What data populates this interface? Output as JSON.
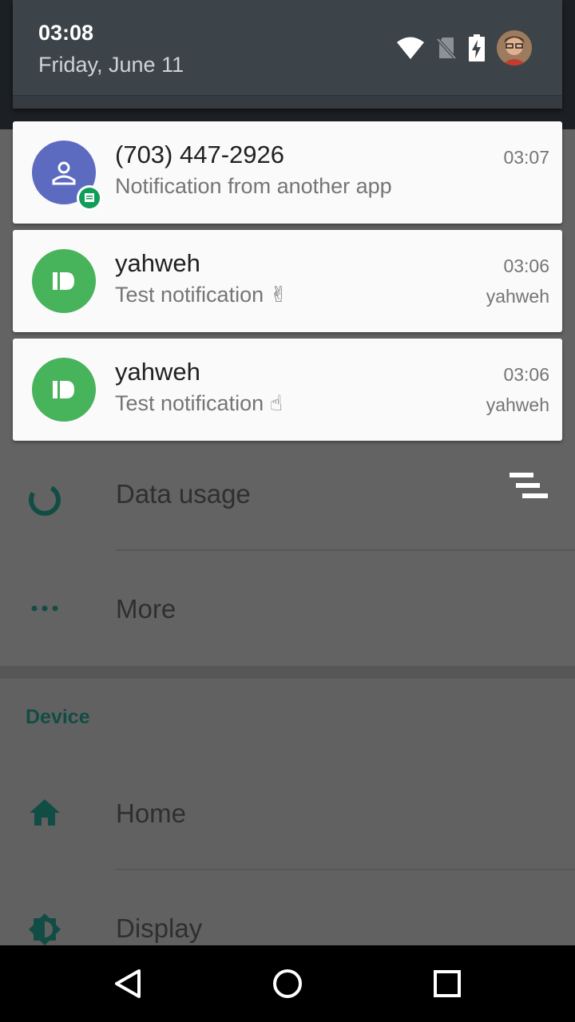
{
  "status": {
    "time": "03:08",
    "date": "Friday, June 11"
  },
  "icons": {
    "wifi": "wifi-icon",
    "no_sim": "no-sim-icon",
    "battery": "battery-charging-icon",
    "avatar": "user-avatar",
    "notification_contact": "person-icon",
    "notification_app": "pushbullet-icon",
    "badge": "sms-message-icon",
    "data_usage": "data-usage-icon",
    "more": "more-dots-icon",
    "home": "home-icon",
    "display": "brightness-icon",
    "dismiss_all": "clear-all-icon"
  },
  "colors": {
    "contact_circle": "#5c6bc0",
    "app_circle": "#47b35b",
    "badge_green": "#0f9d58",
    "section_title": "#124d45",
    "settings_icon": "#124d45"
  },
  "notifications": [
    {
      "title": "(703) 447-2926",
      "text": "Notification from another app",
      "time": "03:07",
      "sub": ""
    },
    {
      "title": "yahweh",
      "text": "Test notification ✌",
      "time": "03:06",
      "sub": "yahweh"
    },
    {
      "title": "yahweh",
      "text": "Test notification ☝",
      "time": "03:06",
      "sub": "yahweh"
    }
  ],
  "settings": {
    "rows": [
      {
        "label": "Data usage"
      },
      {
        "label": "More"
      }
    ],
    "device_section": "Device",
    "device_rows": [
      {
        "label": "Home"
      },
      {
        "label": "Display"
      }
    ]
  }
}
